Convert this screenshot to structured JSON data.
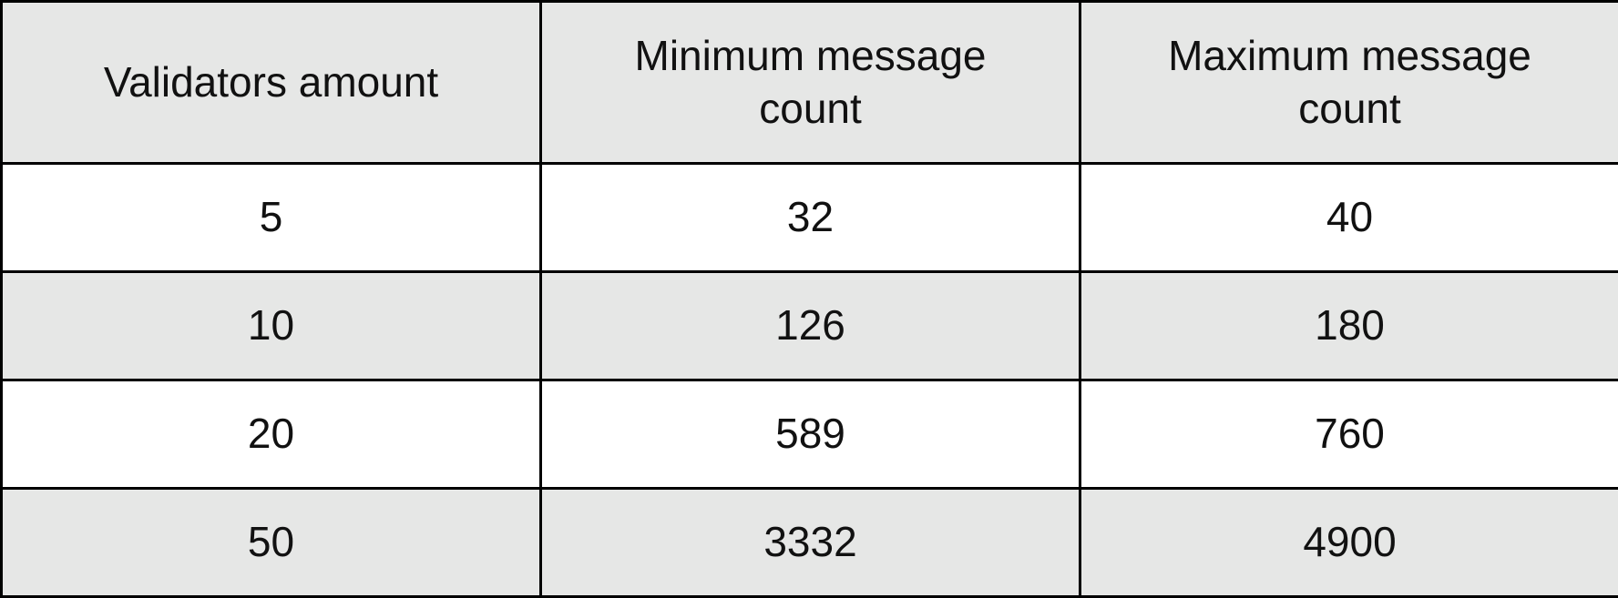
{
  "table": {
    "columns": [
      "Validators amount",
      "Minimum message count",
      "Maximum message count"
    ],
    "header_line_breaks": [
      [
        "Validators amount"
      ],
      [
        "Minimum message",
        "count"
      ],
      [
        "Maximum message",
        "count"
      ]
    ],
    "rows": [
      [
        "5",
        "32",
        "40"
      ],
      [
        "10",
        "126",
        "180"
      ],
      [
        "20",
        "589",
        "760"
      ],
      [
        "50",
        "3332",
        "4900"
      ]
    ]
  },
  "colors": {
    "header_background": "#e6e7e6",
    "shaded_row_background": "#e6e7e6",
    "plain_row_background": "#ffffff",
    "border": "#000000"
  }
}
